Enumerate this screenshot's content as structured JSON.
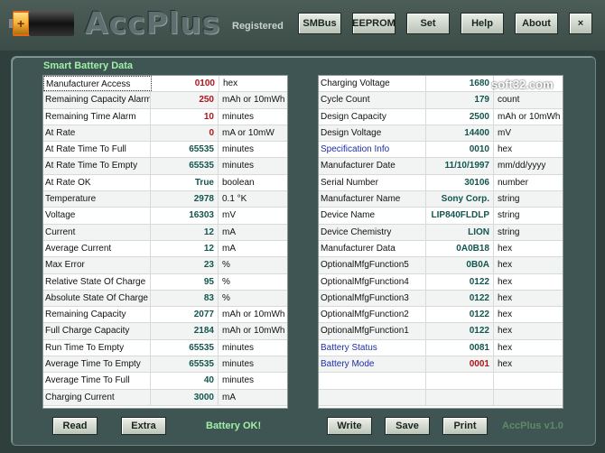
{
  "header": {
    "title": "AccPlus",
    "registration": "Registered",
    "buttons": [
      "SMBus",
      "EEPROM",
      "Set",
      "Help",
      "About",
      "×"
    ]
  },
  "panel": {
    "title": "Smart Battery Data"
  },
  "left_rows": [
    {
      "name": "Manufacturer Access",
      "value": "0100",
      "unit": "hex",
      "value_color": "red"
    },
    {
      "name": "Remaining Capacity Alarm",
      "value": "250",
      "unit": "mAh or 10mWh",
      "value_color": "red"
    },
    {
      "name": "Remaining Time Alarm",
      "value": "10",
      "unit": "minutes",
      "value_color": "red"
    },
    {
      "name": "At Rate",
      "value": "0",
      "unit": "mA or 10mW",
      "value_color": "red"
    },
    {
      "name": "At Rate Time To Full",
      "value": "65535",
      "unit": "minutes"
    },
    {
      "name": "At Rate Time To Empty",
      "value": "65535",
      "unit": "minutes"
    },
    {
      "name": "At Rate OK",
      "value": "True",
      "unit": "boolean"
    },
    {
      "name": "Temperature",
      "value": "2978",
      "unit": "0.1 °K"
    },
    {
      "name": "Voltage",
      "value": "16303",
      "unit": "mV"
    },
    {
      "name": "Current",
      "value": "12",
      "unit": "mA"
    },
    {
      "name": "Average Current",
      "value": "12",
      "unit": "mA"
    },
    {
      "name": "Max Error",
      "value": "23",
      "unit": "%"
    },
    {
      "name": "Relative State Of Charge",
      "value": "95",
      "unit": "%"
    },
    {
      "name": "Absolute State Of Charge",
      "value": "83",
      "unit": "%"
    },
    {
      "name": "Remaining Capacity",
      "value": "2077",
      "unit": "mAh or 10mWh"
    },
    {
      "name": "Full Charge Capacity",
      "value": "2184",
      "unit": "mAh or 10mWh"
    },
    {
      "name": "Run Time To Empty",
      "value": "65535",
      "unit": "minutes"
    },
    {
      "name": "Average Time To Empty",
      "value": "65535",
      "unit": "minutes"
    },
    {
      "name": "Average Time To Full",
      "value": "40",
      "unit": "minutes"
    },
    {
      "name": "Charging Current",
      "value": "3000",
      "unit": "mA"
    }
  ],
  "right_rows": [
    {
      "name": "Charging Voltage",
      "value": "1680",
      "unit": ""
    },
    {
      "name": "Cycle Count",
      "value": "179",
      "unit": "count"
    },
    {
      "name": "Design Capacity",
      "value": "2500",
      "unit": "mAh or 10mWh"
    },
    {
      "name": "Design Voltage",
      "value": "14400",
      "unit": "mV"
    },
    {
      "name": "Specification Info",
      "value": "0010",
      "unit": "hex",
      "name_color": "blue"
    },
    {
      "name": "Manufacturer Date",
      "value": "11/10/1997",
      "unit": "mm/dd/yyyy"
    },
    {
      "name": "Serial Number",
      "value": "30106",
      "unit": "number"
    },
    {
      "name": "Manufacturer Name",
      "value": "Sony Corp.",
      "unit": "string"
    },
    {
      "name": "Device Name",
      "value": "LIP840FLDLP",
      "unit": "string"
    },
    {
      "name": "Device Chemistry",
      "value": "LION",
      "unit": "string"
    },
    {
      "name": "Manufacturer Data",
      "value": "0A0B18",
      "unit": "hex"
    },
    {
      "name": "OptionalMfgFunction5",
      "value": "0B0A",
      "unit": "hex"
    },
    {
      "name": "OptionalMfgFunction4",
      "value": "0122",
      "unit": "hex"
    },
    {
      "name": "OptionalMfgFunction3",
      "value": "0122",
      "unit": "hex"
    },
    {
      "name": "OptionalMfgFunction2",
      "value": "0122",
      "unit": "hex"
    },
    {
      "name": "OptionalMfgFunction1",
      "value": "0122",
      "unit": "hex"
    },
    {
      "name": "Battery Status",
      "value": "0081",
      "unit": "hex",
      "name_color": "blue"
    },
    {
      "name": "Battery Mode",
      "value": "0001",
      "unit": "hex",
      "name_color": "blue",
      "value_color": "red"
    },
    {
      "name": "",
      "value": "",
      "unit": ""
    },
    {
      "name": "",
      "value": "",
      "unit": ""
    }
  ],
  "footer": {
    "read": "Read",
    "extra": "Extra",
    "status": "Battery OK!",
    "write": "Write",
    "save": "Save",
    "print": "Print",
    "version": "AccPlus v1.0"
  },
  "watermark": "soft32.com",
  "colors": {
    "ok_green": "#9ff0a6",
    "hex_red": "#b0141c",
    "value_teal": "#12564f",
    "link_blue": "#1f2ea8"
  }
}
